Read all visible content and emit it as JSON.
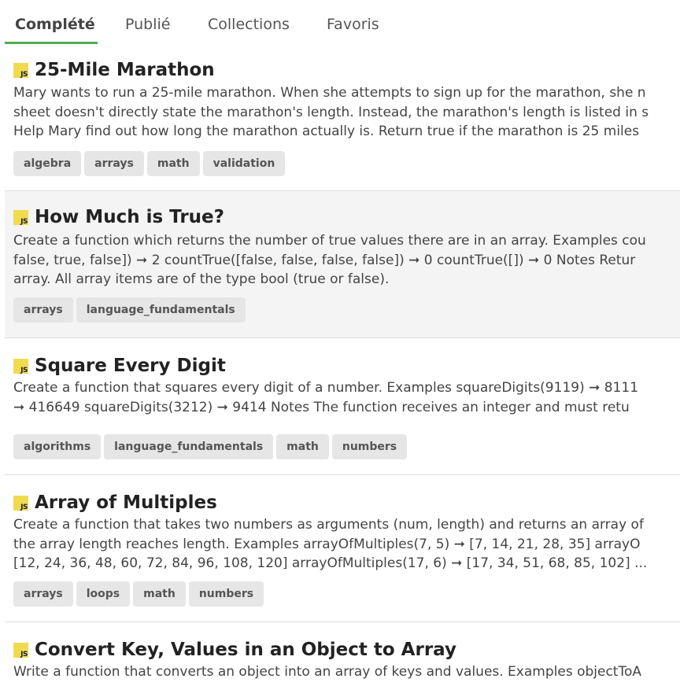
{
  "tabs": [
    "Complété",
    "Publié",
    "Collections",
    "Favoris"
  ],
  "active_tab": "Complété",
  "lang_badge": "JS",
  "colors": {
    "accent": "#4caf50",
    "js_badge": "#f0db4f",
    "tag_bg": "#e6e6e6",
    "hover_bg": "#f4f4f4"
  },
  "challenges": [
    {
      "title": "25-Mile Marathon",
      "description": [
        "Mary wants to run a 25-mile marathon. When she attempts to sign up for the marathon, she n",
        "sheet doesn't directly state the marathon's length. Instead, the marathon's length is listed in s",
        "Help Mary find out how long the marathon actually is. Return true if the marathon is 25 miles"
      ],
      "tags": [
        "algebra",
        "arrays",
        "math",
        "validation"
      ]
    },
    {
      "title": "How Much is True?",
      "description": [
        "Create a function which returns the number of true values there are in an array. Examples cou",
        "false, true, false]) ➞ 2 countTrue([false, false, false, false]) ➞ 0 countTrue([]) ➞ 0 Notes Retur",
        "array. All array items are of the type bool (true or false)."
      ],
      "tags": [
        "arrays",
        "language_fundamentals"
      ]
    },
    {
      "title": "Square Every Digit",
      "description": [
        "Create a function that squares every digit of a number. Examples squareDigits(9119) ➞ 8111",
        "➞ 416649 squareDigits(3212) ➞ 9414 Notes The function receives an integer and must retu"
      ],
      "tags": [
        "algorithms",
        "language_fundamentals",
        "math",
        "numbers"
      ]
    },
    {
      "title": "Array of Multiples",
      "description": [
        "Create a function that takes two numbers as arguments (num, length) and returns an array of",
        "the array length reaches length. Examples arrayOfMultiples(7, 5) ➞ [7, 14, 21, 28, 35] arrayO",
        "[12, 24, 36, 48, 60, 72, 84, 96, 108, 120] arrayOfMultiples(17, 6) ➞ [17, 34, 51, 68, 85, 102] ..."
      ],
      "tags": [
        "arrays",
        "loops",
        "math",
        "numbers"
      ]
    },
    {
      "title": "Convert Key, Values in an Object to Array",
      "description": [
        "Write a function that converts an object into an array of keys and values. Examples objectToA"
      ],
      "tags": []
    }
  ]
}
